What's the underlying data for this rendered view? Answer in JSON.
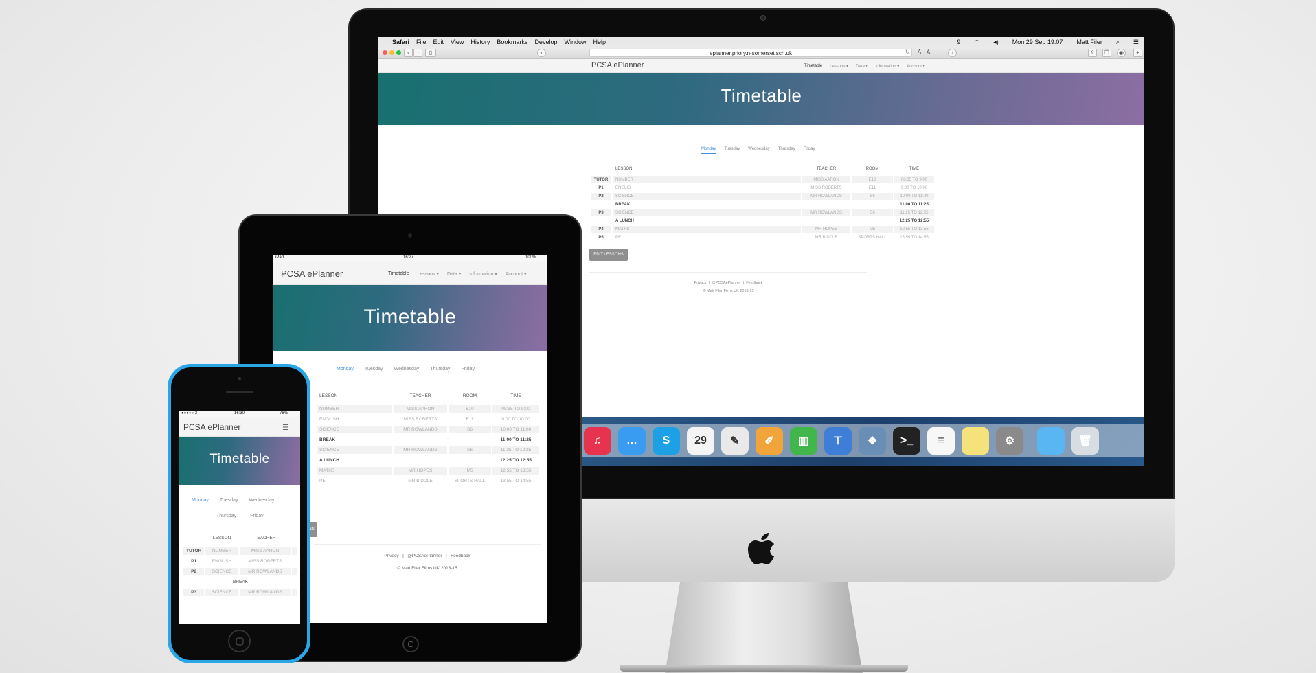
{
  "desktop": {
    "menubar": {
      "apple": "",
      "app": "Safari",
      "items": [
        "File",
        "Edit",
        "View",
        "History",
        "Bookmarks",
        "Develop",
        "Window",
        "Help"
      ],
      "status_badge": "9",
      "clock": "Mon 29 Sep  19:07",
      "user": "Matt Filer"
    },
    "browser": {
      "url": "eplanner.priory.n-somerset.sch.uk",
      "reader_a_small": "A",
      "reader_a_large": "A"
    },
    "site": {
      "brand": "PCSA ePlanner",
      "nav": [
        "Timetable",
        "Lessons ▾",
        "Data ▾",
        "Information ▾",
        "Account ▾"
      ],
      "hero_title": "Timetable",
      "days": [
        "Monday",
        "Tuesday",
        "Wednesday",
        "Thursday",
        "Friday"
      ],
      "columns": [
        "LESSON",
        "TEACHER",
        "ROOM",
        "TIME"
      ],
      "rows": [
        {
          "period": "TUTOR",
          "lesson": "NUMBER",
          "teacher": "MISS AARON",
          "room": "E10",
          "time": "08:35 TO 9:00"
        },
        {
          "period": "P1",
          "lesson": "ENGLISH",
          "teacher": "MISS ROBERTS",
          "room": "E11",
          "time": "9:00 TO 10:00"
        },
        {
          "period": "P2",
          "lesson": "SCIENCE",
          "teacher": "MR ROWLANDS",
          "room": "S6",
          "time": "10:00 TO 11:00"
        },
        {
          "period": "",
          "lesson": "BREAK",
          "teacher": "",
          "room": "",
          "time": "11:00 TO 11:25"
        },
        {
          "period": "P3",
          "lesson": "SCIENCE",
          "teacher": "MR ROWLANDS",
          "room": "S6",
          "time": "11:25 TO 12:25"
        },
        {
          "period": "",
          "lesson": "A LUNCH",
          "teacher": "",
          "room": "",
          "time": "12:25 TO 12:55"
        },
        {
          "period": "P4",
          "lesson": "MATHS",
          "teacher": "MR HOPES",
          "room": "M5",
          "time": "12:55 TO 13:55"
        },
        {
          "period": "P5",
          "lesson": "PE",
          "teacher": "MR BIDDLE",
          "room": "SPORTS HALL",
          "time": "13:55 TO 14:55"
        }
      ],
      "edit_button": "EDIT LESSONS",
      "footer_links": [
        "Privacy",
        "@PCSAePlanner",
        "Feedback"
      ],
      "footer_sep": "|",
      "copyright": "© Matt Filer Films UK 2013-15"
    },
    "dock": [
      {
        "icon": "itunes-icon",
        "glyph": "♫",
        "color": "#e8334f"
      },
      {
        "icon": "messages-icon",
        "glyph": "…",
        "color": "#3a9cf0"
      },
      {
        "icon": "skype-icon",
        "glyph": "S",
        "color": "#1ea0e6"
      },
      {
        "icon": "calendar-icon",
        "glyph": "29",
        "color": "#f4f4f4"
      },
      {
        "icon": "textedit-icon",
        "glyph": "✎",
        "color": "#e9e9e9"
      },
      {
        "icon": "pages-icon",
        "glyph": "✐",
        "color": "#f1a43a"
      },
      {
        "icon": "numbers-icon",
        "glyph": "▥",
        "color": "#41b64a"
      },
      {
        "icon": "keynote-icon",
        "glyph": "⊤",
        "color": "#3f7ed6"
      },
      {
        "icon": "preview-icon",
        "glyph": "❖",
        "color": "#6a8fb6"
      },
      {
        "icon": "terminal-icon",
        "glyph": ">_",
        "color": "#222222"
      },
      {
        "icon": "reminders-icon",
        "glyph": "≡",
        "color": "#f7f7f7"
      },
      {
        "icon": "notes-icon",
        "glyph": "",
        "color": "#f6e27a"
      },
      {
        "icon": "system-preferences-icon",
        "glyph": "⚙",
        "color": "#8a8a8a"
      },
      {
        "icon": "folder-icon",
        "glyph": "",
        "color": "#59b6f3"
      },
      {
        "icon": "trash-icon",
        "glyph": "🗑",
        "color": "#d7dde3"
      }
    ]
  },
  "tablet": {
    "status": {
      "left": "iPad",
      "time": "16:27",
      "battery": "100%"
    },
    "brand": "PCSA ePlanner",
    "nav": [
      "Timetable",
      "Lessons ▾",
      "Data ▾",
      "Information ▾",
      "Account ▾"
    ],
    "hero_title": "Timetable",
    "days": [
      "Monday",
      "Tuesday",
      "Wednesday",
      "Thursday",
      "Friday"
    ],
    "columns": [
      "LESSON",
      "TEACHER",
      "ROOM",
      "TIME"
    ],
    "rows": [
      {
        "lesson": "NUMBER",
        "teacher": "MISS AARON",
        "room": "E10",
        "time": "08:35 TO 9:00"
      },
      {
        "lesson": "ENGLISH",
        "teacher": "MISS ROBERTS",
        "room": "E11",
        "time": "9:00 TO 10:00"
      },
      {
        "lesson": "SCIENCE",
        "teacher": "MR ROWLANDS",
        "room": "S6",
        "time": "10:00 TO 11:00"
      },
      {
        "lesson": "BREAK",
        "teacher": "",
        "room": "",
        "time": "11:00 TO 11:25"
      },
      {
        "lesson": "SCIENCE",
        "teacher": "MR ROWLANDS",
        "room": "S6",
        "time": "11:25 TO 12:25"
      },
      {
        "lesson": "A LUNCH",
        "teacher": "",
        "room": "",
        "time": "12:25 TO 12:55"
      },
      {
        "lesson": "MATHS",
        "teacher": "MR HOPES",
        "room": "M5",
        "time": "12:55 TO 13:55"
      },
      {
        "lesson": "PE",
        "teacher": "MR BIDDLE",
        "room": "SPORTS HALL",
        "time": "13:55 TO 14:55"
      }
    ],
    "edit_button_partial": "SONS",
    "footer_links": [
      "Privacy",
      "@PCSAePlanner",
      "Feedback"
    ],
    "footer_sep": "|",
    "copyright": "© Matt Filer Films UK 2013-15"
  },
  "phone": {
    "status": {
      "carrier": "●●●○○ 3",
      "time": "16:30",
      "battery": "78%"
    },
    "brand": "PCSA ePlanner",
    "hero_title": "Timetable",
    "days_row1": [
      "Monday",
      "Tuesday",
      "Wednesday"
    ],
    "days_row2": [
      "Thursday",
      "Friday"
    ],
    "columns": [
      "LESSON",
      "TEACHER"
    ],
    "rows": [
      {
        "period": "TUTOR",
        "lesson": "NUMBER",
        "teacher": "MISS AARON"
      },
      {
        "period": "P1",
        "lesson": "ENGLISH",
        "teacher": "MISS ROBERTS"
      },
      {
        "period": "P2",
        "lesson": "SCIENCE",
        "teacher": "MR ROWLANDS"
      },
      {
        "period": "",
        "lesson": "BREAK",
        "teacher": ""
      },
      {
        "period": "P3",
        "lesson": "SCIENCE",
        "teacher": "MR ROWLANDS"
      }
    ]
  },
  "colors": {
    "accent": "#3d8fd8",
    "hero_start": "#18706f",
    "hero_end": "#8c6ea2",
    "phone_case": "#2aa6e6"
  }
}
